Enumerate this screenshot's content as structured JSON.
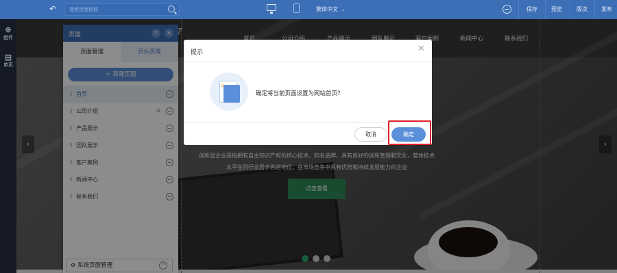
{
  "toolbar": {
    "search_placeholder": "搜索页面标题",
    "language": "繁体中文",
    "save": "保存",
    "preview": "预览",
    "versions": "版次",
    "publish": "发布"
  },
  "rail": {
    "components": "组件",
    "pages": "单页"
  },
  "site": {
    "nav": [
      "首页",
      "公司介绍",
      "产品展示",
      "团队展示",
      "客户案例",
      "新闻中心",
      "联系我们"
    ],
    "logo_fragment": "y",
    "hero_line1": "创新型企业是指拥有自主知识产权的核心技术，知名品牌，具有良好的创新管理和文化，整体技术",
    "hero_line2": "水平在同行业居于先进地位，在市场竞争中具有优势和持续发展能力的企业",
    "hero_button": "点击查看",
    "slide_count": 3,
    "active_slide": 1
  },
  "panel": {
    "title": "页面",
    "tab_pages": "页面管理",
    "tab_header_footer": "页头页尾",
    "new_page": "＋ 新建页面",
    "pages": [
      {
        "label": "首页",
        "active": true
      },
      {
        "label": "公司介绍",
        "active": false
      },
      {
        "label": "产品展示",
        "active": false
      },
      {
        "label": "团队展示",
        "active": false
      },
      {
        "label": "客户案例",
        "active": false
      },
      {
        "label": "新闻中心",
        "active": false
      },
      {
        "label": "联系我们",
        "active": false
      }
    ],
    "system_pages": "系统页面管理"
  },
  "dialog": {
    "title": "提示",
    "message": "确定将当前页面设置为网站首页?",
    "cancel": "取消",
    "confirm": "确定"
  },
  "colors": {
    "brand": "#3d6fb7",
    "button": "#5b8fd9",
    "highlight": "#e0202a",
    "hero_button": "#2e8b57"
  }
}
